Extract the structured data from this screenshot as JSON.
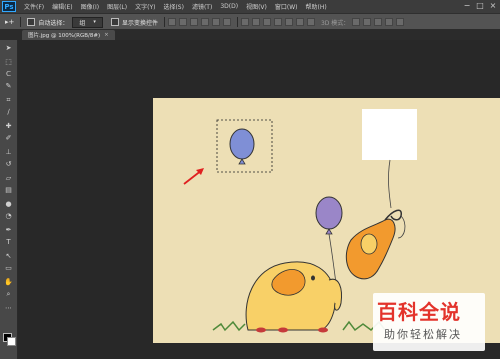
{
  "app": {
    "logo": "Ps"
  },
  "menu": [
    "文件(F)",
    "编辑(E)",
    "图像(I)",
    "图层(L)",
    "文字(Y)",
    "选择(S)",
    "滤镜(T)",
    "3D(D)",
    "视图(V)",
    "窗口(W)",
    "帮助(H)"
  ],
  "options": {
    "auto_select_label": "自动选择：",
    "auto_select_value": "组",
    "show_transform_label": "显示变换控件",
    "mode_3d_label": "3D 模式："
  },
  "document_tab": {
    "title": "图片.jpg @ 100%(RGB/8#)",
    "close": "×"
  },
  "tools": [
    "move-icon",
    "marquee-icon",
    "lasso-icon",
    "quick-select-icon",
    "crop-icon",
    "eyedropper-icon",
    "healing-icon",
    "brush-icon",
    "stamp-icon",
    "history-brush-icon",
    "eraser-icon",
    "gradient-icon",
    "blur-icon",
    "dodge-icon",
    "pen-icon",
    "type-icon",
    "path-select-icon",
    "shape-icon",
    "hand-icon",
    "zoom-icon"
  ],
  "watermark": {
    "title": "百科全说",
    "subtitle": "助你轻松解决"
  },
  "colors": {
    "menubar": "#3c3c3c",
    "options": "#535353",
    "workspace": "#282828",
    "canvas": "#eddfb5",
    "arrow": "#e02020",
    "balloon_blue": "#7f8fd6",
    "balloon_purple": "#9a86c8",
    "elephant_yellow": "#f8d067",
    "elephant_orange": "#f29a2e"
  }
}
